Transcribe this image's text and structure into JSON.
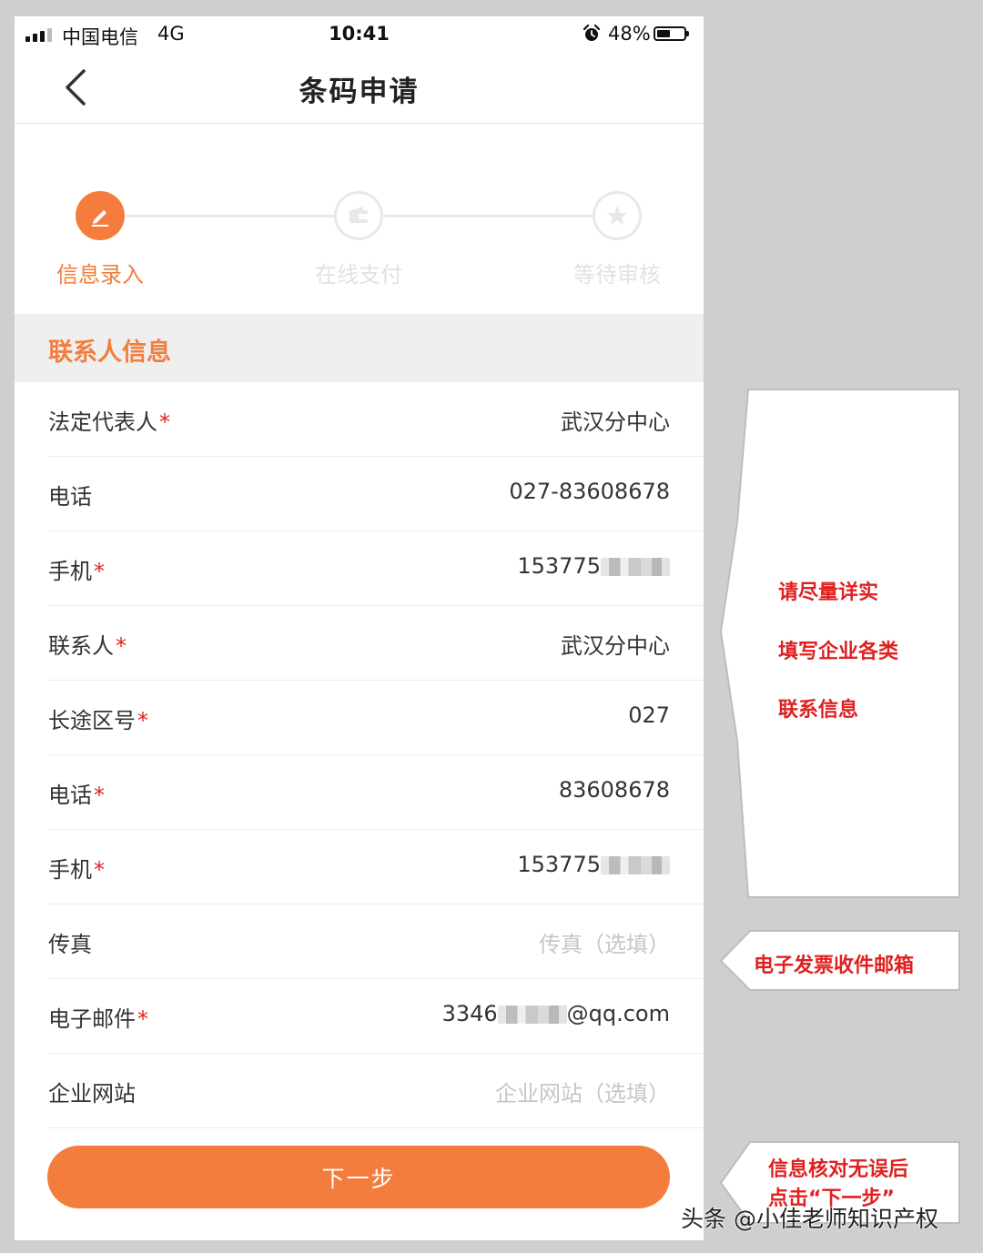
{
  "status_bar": {
    "carrier": "中国电信",
    "network": "4G",
    "time": "10:41",
    "battery": "48%"
  },
  "nav": {
    "title": "条码申请"
  },
  "progress": {
    "steps": [
      {
        "label": "信息录入",
        "state": "active",
        "icon": "edit-icon"
      },
      {
        "label": "在线支付",
        "state": "inactive",
        "icon": "wallet-icon"
      },
      {
        "label": "等待审核",
        "state": "inactive",
        "icon": "star-icon"
      }
    ]
  },
  "section": {
    "title": "联系人信息"
  },
  "form": {
    "rows": [
      {
        "label": "法定代表人",
        "required": "*",
        "value": "武汉分中心"
      },
      {
        "label": "电话",
        "required": "",
        "value": "027-83608678"
      },
      {
        "label": "手机",
        "required": "*",
        "value": "153775"
      },
      {
        "label": "联系人",
        "required": "*",
        "value": "武汉分中心"
      },
      {
        "label": "长途区号",
        "required": "*",
        "value": "027"
      },
      {
        "label": "电话",
        "required": "*",
        "value": "83608678"
      },
      {
        "label": "手机",
        "required": "*",
        "value": "153775"
      },
      {
        "label": "传真",
        "required": "",
        "placeholder": "传真（选填）"
      },
      {
        "label": "电子邮件",
        "required": "*",
        "value_prefix": "3346",
        "value_suffix": "@qq.com"
      },
      {
        "label": "企业网站",
        "required": "",
        "placeholder": "企业网站（选填）"
      }
    ]
  },
  "next_button": {
    "label": "下一步"
  },
  "callouts": {
    "contact": [
      "请尽量详实",
      "填写企业各类",
      "联系信息"
    ],
    "email": "电子发票收件邮箱",
    "next": [
      "信息核对无误后",
      "点击“下一步”"
    ]
  },
  "watermark": "头条 @小佳老师知识产权",
  "colors": {
    "accent": "#f47d3e",
    "required": "#e02020",
    "callout_text": "#e02020"
  }
}
